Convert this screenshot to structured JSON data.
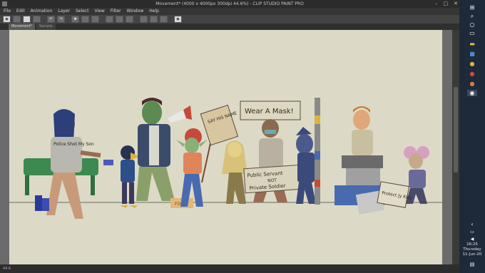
{
  "window": {
    "title": "Movement* (4000 x 4000px 300dpi 44.6%) - CLIP STUDIO PAINT PRO"
  },
  "menu": [
    "File",
    "Edit",
    "Animation",
    "Layer",
    "Select",
    "View",
    "Filter",
    "Window",
    "Help"
  ],
  "tabs": [
    "Movement*",
    "Sample"
  ],
  "status": {
    "zoom": "44.6"
  },
  "artwork": {
    "sign_wear_mask": "Wear A Mask!",
    "sign_say_his_name": "SAY HIS NAME",
    "sign_public_servant_line1": "Public Servant",
    "sign_public_servant_line2": "NOT",
    "sign_public_servant_line3": "Private Soldier",
    "shirt_text": "Police Shot My Son",
    "small_sign": "Protect Jy Kids",
    "crate_label": "FOOT"
  },
  "taskbar": {
    "time": "16:25",
    "day": "Thursday",
    "date": "11-Jun-20"
  },
  "colors": {
    "paper": "#dcdac6",
    "workspace": "#6b6b6b",
    "taskbar": "#1e2a3a"
  }
}
